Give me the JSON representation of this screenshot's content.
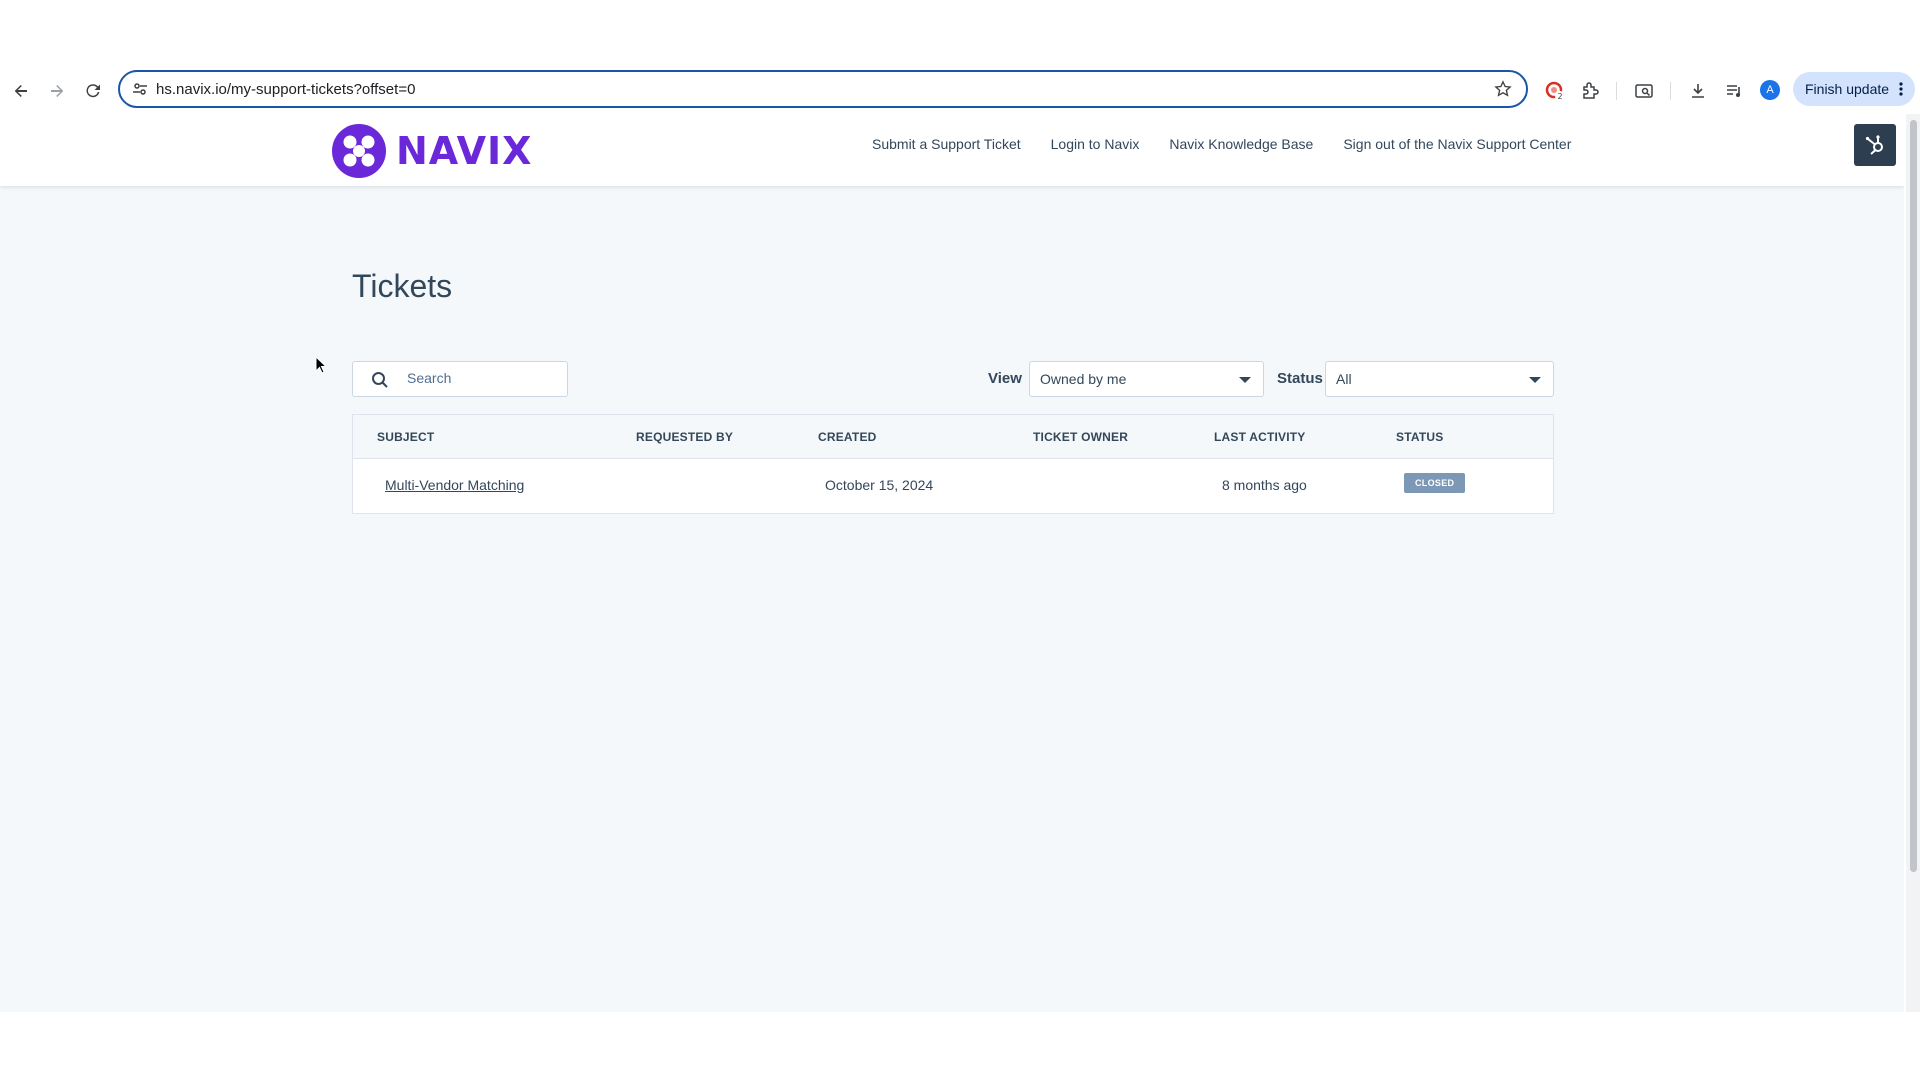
{
  "browser": {
    "url": "hs.navix.io/my-support-tickets?offset=0",
    "profile_initial": "A",
    "finish_update_label": "Finish update"
  },
  "site": {
    "logo_text": "NAVIX",
    "nav": [
      "Submit a Support Ticket",
      "Login to Navix",
      "Navix Knowledge Base",
      "Sign out of the Navix Support Center"
    ]
  },
  "page": {
    "title": "Tickets",
    "search_placeholder": "Search",
    "view_label": "View",
    "view_value": "Owned by me",
    "status_label": "Status",
    "status_value": "All"
  },
  "table": {
    "columns": [
      "SUBJECT",
      "REQUESTED BY",
      "CREATED",
      "TICKET OWNER",
      "LAST ACTIVITY",
      "STATUS"
    ],
    "rows": [
      {
        "subject": "Multi-Vendor Matching",
        "requested_by": "",
        "created": "October 15, 2024",
        "ticket_owner": "",
        "last_activity": "8 months ago",
        "status": "CLOSED"
      }
    ]
  },
  "colors": {
    "brand": "#6b28d9",
    "badge_closed": "#7c98b6",
    "omnibox_focus": "#1a56a8"
  }
}
